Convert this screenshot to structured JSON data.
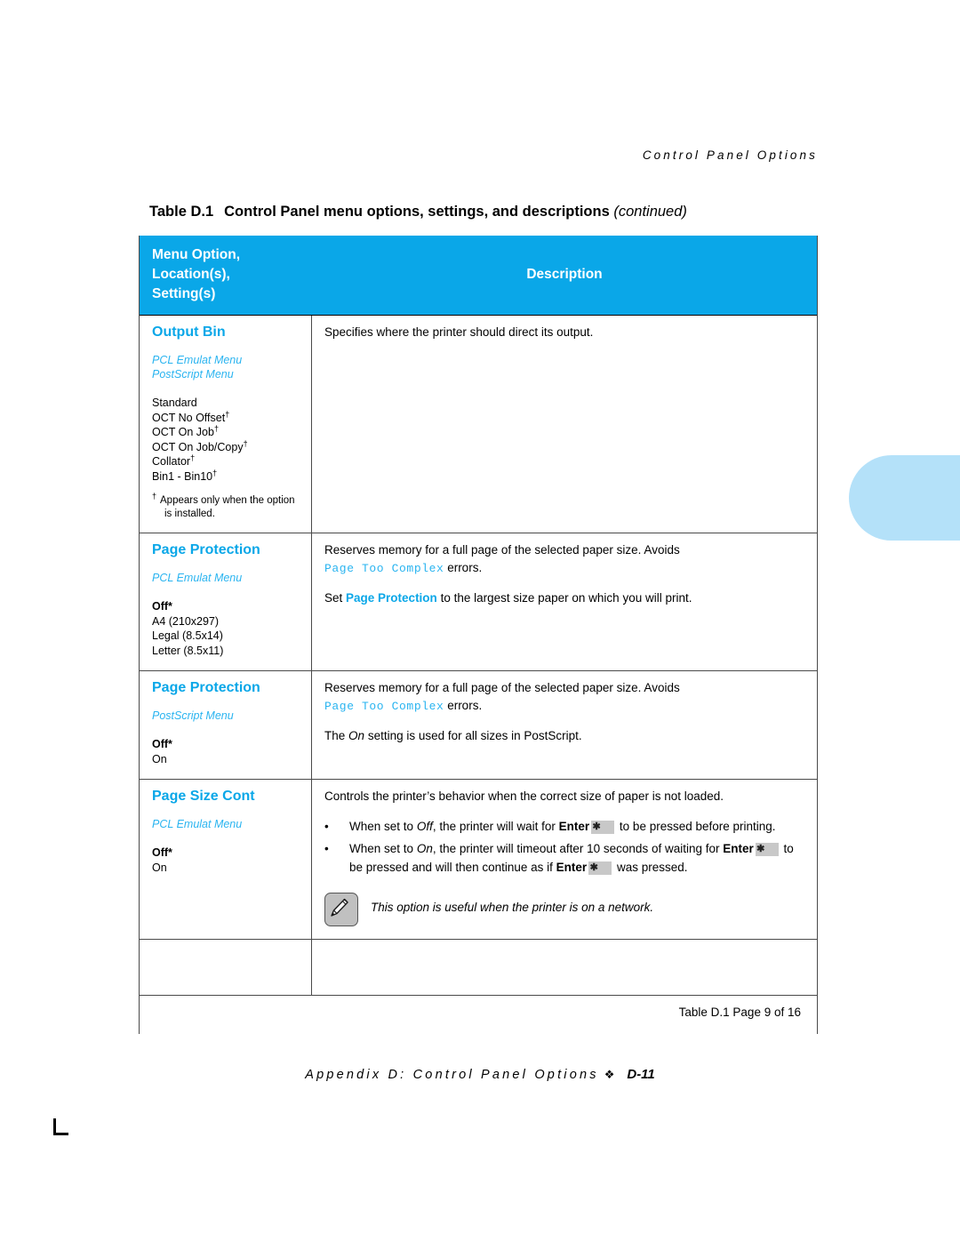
{
  "running_head": "Control Panel Options",
  "caption": {
    "number": "Table D.1",
    "title": "Control Panel menu options, settings, and descriptions",
    "continued": "(continued)"
  },
  "table": {
    "header": {
      "col_a_line1": "Menu Option,",
      "col_a_line2": "Location(s),",
      "col_a_line3": "Setting(s)",
      "col_b": "Description"
    },
    "rows": [
      {
        "option": "Output Bin",
        "locations": [
          "PCL Emulat Menu",
          "PostScript Menu"
        ],
        "settings": [
          "Standard",
          "OCT No Offset",
          "OCT On Job",
          "OCT On Job/Copy",
          "Collator",
          "Bin1 - Bin10"
        ],
        "footnote": "Appears only when the option is installed.",
        "description_p1": "Specifies where the printer should direct its output."
      },
      {
        "option": "Page Protection",
        "locations": [
          "PCL Emulat Menu"
        ],
        "settings_default": "Off*",
        "settings": [
          "A4 (210x297)",
          "Legal (8.5x14)",
          "Letter (8.5x11)"
        ],
        "desc_line1_a": "Reserves memory for a full page of the selected paper size. Avoids",
        "desc_code": "Page Too Complex",
        "desc_line1_b": "errors.",
        "desc_p2_a": "Set",
        "desc_p2_blue": "Page Protection",
        "desc_p2_b": "to the largest size paper on which you will print."
      },
      {
        "option": "Page Protection",
        "locations": [
          "PostScript Menu"
        ],
        "settings_default": "Off*",
        "settings": [
          "On"
        ],
        "desc_line1_a": "Reserves memory for a full page of the selected paper size. Avoids",
        "desc_code": "Page Too Complex",
        "desc_line1_b": "errors.",
        "desc_p2_a": "The",
        "desc_p2_italic": "On",
        "desc_p2_b": "setting is used for all sizes in PostScript."
      },
      {
        "option": "Page Size Cont",
        "locations": [
          "PCL Emulat Menu"
        ],
        "settings_default": "Off*",
        "settings": [
          "On"
        ],
        "desc_intro": "Controls the printer’s behavior when the correct size of paper is not loaded.",
        "bullet1_a": "When set to",
        "bullet1_italic": "Off",
        "bullet1_b": ", the printer will wait for",
        "bullet1_key": "Enter",
        "bullet1_c": "to be pressed before printing.",
        "bullet2_a": "When set to",
        "bullet2_italic": "On",
        "bullet2_b": ", the printer will timeout after 10 seconds of waiting for",
        "bullet2_key1": "Enter",
        "bullet2_c": "to be pressed and will then continue as if",
        "bullet2_key2": "Enter",
        "bullet2_d": "was pressed.",
        "note_text": "This option is useful when the printer is on a network."
      }
    ],
    "footer": "Table D.1  Page 9 of 16"
  },
  "page_footer": {
    "title": "Appendix D: Control Panel Options",
    "diamond": "❖",
    "number": "D-11"
  },
  "keycap_glyph": "✱",
  "dagger": "†",
  "colors": {
    "header_blue": "#0aa7e8",
    "accent_blue": "#2ab4f0",
    "tab_blue": "#b4e1f9",
    "rule": "#4a4a4a"
  }
}
